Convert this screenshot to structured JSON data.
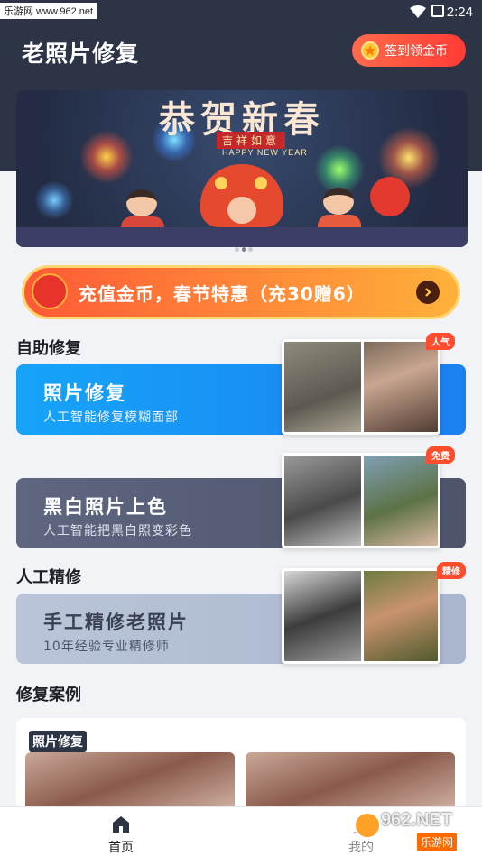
{
  "status_bar": {
    "watermark": "乐游网 www.962.net",
    "time": "2:24"
  },
  "header": {
    "title": "老照片修复",
    "signin_label": "签到领金币"
  },
  "banner": {
    "title": "恭贺新春",
    "chip": "吉祥如意",
    "subtitle_en": "HAPPY NEW YEAR",
    "active_index": 1,
    "count": 3
  },
  "promo": {
    "text": "充值金币，春节特惠（充30赠6）"
  },
  "sections": {
    "self_service": "自助修复",
    "manual": "人工精修",
    "cases": "修复案例"
  },
  "cards": [
    {
      "title": "照片修复",
      "desc": "人工智能修复模糊面部",
      "tag": "人气"
    },
    {
      "title": "黑白照片上色",
      "desc": "人工智能把黑白照变彩色",
      "tag": "免费"
    },
    {
      "title": "手工精修老照片",
      "desc": "10年经验专业精修师",
      "tag": "精修"
    }
  ],
  "case_panel": {
    "tag": "照片修复"
  },
  "bottom_nav": {
    "home": "首页",
    "mine": "我的"
  },
  "corner_mark": {
    "text": "962.NET",
    "sub": "乐游网"
  },
  "colors": {
    "header_bg": "#2d3446",
    "accent": "#ff4d2e",
    "card1": "#1a8ff5",
    "card2": "#5a6178",
    "card3": "#b6c1d6"
  }
}
